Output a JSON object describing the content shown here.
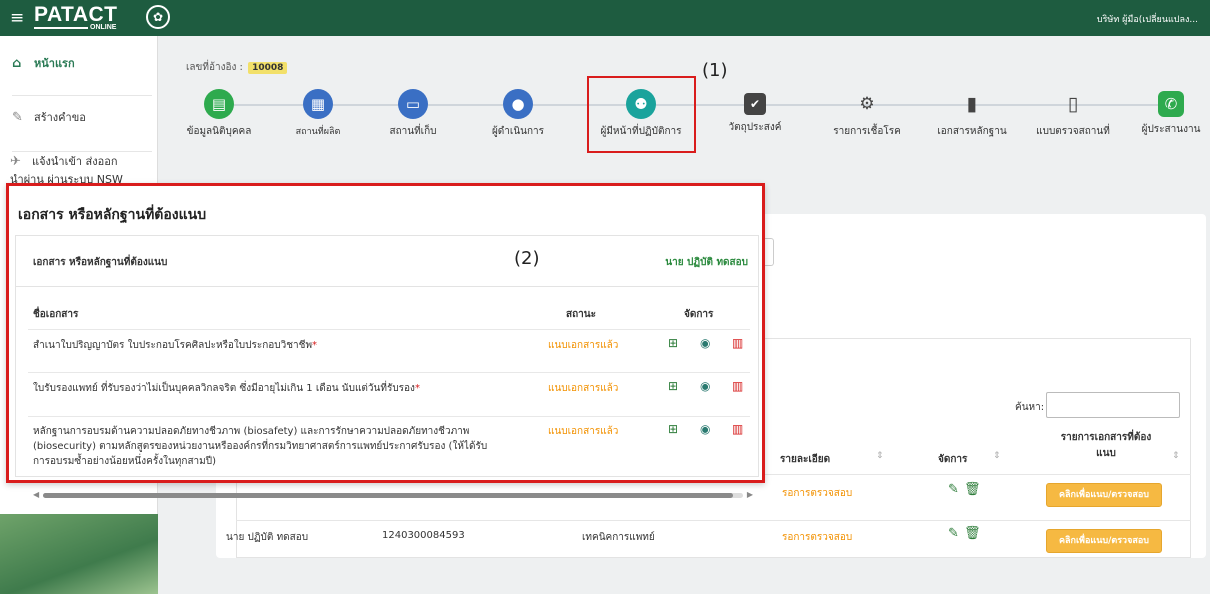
{
  "topbar": {
    "logo": "PATACT",
    "logo_sub": "ONLINE",
    "user": "บริษัท ผู้มือ(เปลี่ยนแปลง..."
  },
  "sidebar": {
    "items": [
      {
        "label": "หน้าแรก",
        "icon": "home-icon"
      },
      {
        "label": "สร้างคำขอ",
        "icon": "pencil-icon"
      },
      {
        "label": "แจ้งนำเข้า ส่งออก",
        "label2": "นำผ่าน ผ่านระบบ NSW",
        "icon": "plane-icon"
      }
    ]
  },
  "reference": {
    "label": "เลขที่อ้างอิง :",
    "value": "10008"
  },
  "steps": [
    {
      "label": "ข้อมูลนิติบุคคล",
      "icon": "id-card-icon",
      "color": "#2eaa4e"
    },
    {
      "label": "สถานที่ผลิต",
      "icon": "building-icon",
      "color": "#3a6fc4"
    },
    {
      "label": "สถานที่เก็บ",
      "icon": "archive-icon",
      "color": "#3a6fc4"
    },
    {
      "label": "ผู้ดำเนินการ",
      "icon": "user-icon",
      "color": "#3a6fc4"
    },
    {
      "label": "ผู้มีหน้าที่ปฏิบัติการ",
      "icon": "users-icon",
      "color": "#1aa39c"
    },
    {
      "label": "วัตถุประสงค์",
      "icon": "check-square-icon",
      "color": "#444444"
    },
    {
      "label": "รายการเชื้อโรค",
      "icon": "cogs-icon",
      "color": "#444444"
    },
    {
      "label": "เอกสารหลักฐาน",
      "icon": "file-icon",
      "color": "#444444"
    },
    {
      "label": "แบบตรวจสถานที่",
      "icon": "clipboard-icon",
      "color": "#444444"
    },
    {
      "label": "ผู้ประสานงาน",
      "icon": "phone-icon",
      "color": "#2eaa4e"
    }
  ],
  "annotations": {
    "one": "(1)",
    "two": "(2)"
  },
  "background_table": {
    "search_label": "ค้นหา:",
    "headers": {
      "detail": "รายละเอียด",
      "manage": "จัดการ",
      "attach_1": "รายการเอกสารที่ต้อง",
      "attach_2": "แนบ"
    },
    "rows": [
      {
        "name": "",
        "id": "",
        "role": "",
        "status": "รอการตรวจสอบ",
        "button": "คลิกเพื่อแนบ/ตรวจสอบ"
      },
      {
        "name": "นาย ปฏิบัติ ทดสอบ",
        "id": "1240300084593",
        "role": "เทคนิคการแพทย์",
        "status": "รอการตรวจสอบ",
        "button": "คลิกเพื่อแนบ/ตรวจสอบ"
      }
    ]
  },
  "panel": {
    "title": "เอกสาร หรือหลักฐานที่ต้องแนบ",
    "subtitle": "เอกสาร หรือหลักฐานที่ต้องแนบ",
    "person": "นาย ปฏิบัติ ทดสอบ",
    "headers": {
      "doc": "ชื่อเอกสาร",
      "status": "สถานะ",
      "manage": "จัดการ"
    },
    "rows": [
      {
        "text": "สำเนาใบปริญญาบัตร ใบประกอบโรคศิลปะหรือใบประกอบวิชาชีพ",
        "required": "*",
        "status": "แนบเอกสารแล้ว"
      },
      {
        "text": "ใบรับรองแพทย์ ที่รับรองว่าไม่เป็นบุคคลวิกลจริต ซึ่งมีอายุไม่เกิน 1 เดือน นับแต่วันที่รับรอง",
        "required": "*",
        "status": "แนบเอกสารแล้ว"
      },
      {
        "text": "หลักฐานการอบรมด้านความปลอดภัยทางชีวภาพ (biosafety) และการรักษาความปลอดภัยทางชีวภาพ",
        "text2": "(biosecurity) ตามหลักสูตรของหน่วยงานหรือองค์กรที่กรมวิทยาศาสตร์การแพทย์ประกาศรับรอง (ให้ได้รับ",
        "text3": "การอบรมซ้ำอย่างน้อยหนึ่งครั้งในทุกสามปี)",
        "required": "",
        "status": "แนบเอกสารแล้ว"
      }
    ]
  }
}
